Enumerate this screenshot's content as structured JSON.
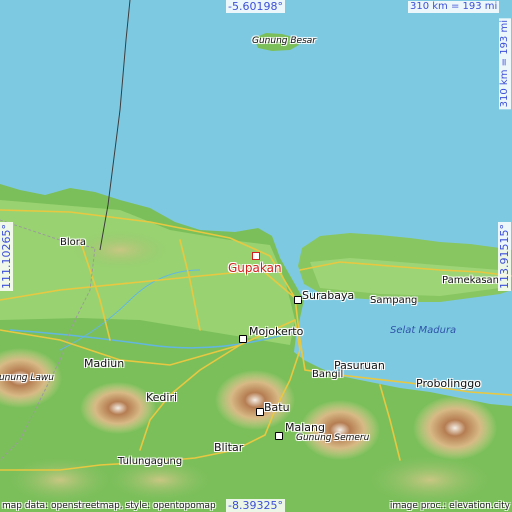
{
  "map": {
    "target": {
      "name": "Gupakan"
    },
    "coordinates": {
      "top": "-5.60198°",
      "bottom": "-8.39325°",
      "left": "111.10265°",
      "right": "113.91515°"
    },
    "scale": {
      "top": "310 km = 193 mi",
      "right": "310 km = 193 mi"
    },
    "cities": {
      "surabaya": "Surabaya",
      "mojokerto": "Mojokerto",
      "pasuruan": "Pasuruan",
      "probolinggo": "Probolinggo",
      "madiun": "Madiun",
      "kediri": "Kediri",
      "blitar": "Blitar",
      "malang": "Malang",
      "batu": "Batu",
      "blora": "Blora",
      "sampang": "Sampang",
      "pamekasan": "Pamekasan",
      "bangil": "Bangil",
      "tulungagung": "Tulungagung"
    },
    "peaks": {
      "gunung_besar": "Gunung Besar",
      "gunung_semeru": "Gunung Semeru",
      "gunung_lawu": "Gunung Lawu"
    },
    "seas": {
      "selat_madura": "Selat Madura"
    },
    "credits": {
      "left": "map data: openstreetmap, style: opentopomap",
      "right": "image proc.: elevation.city"
    }
  }
}
